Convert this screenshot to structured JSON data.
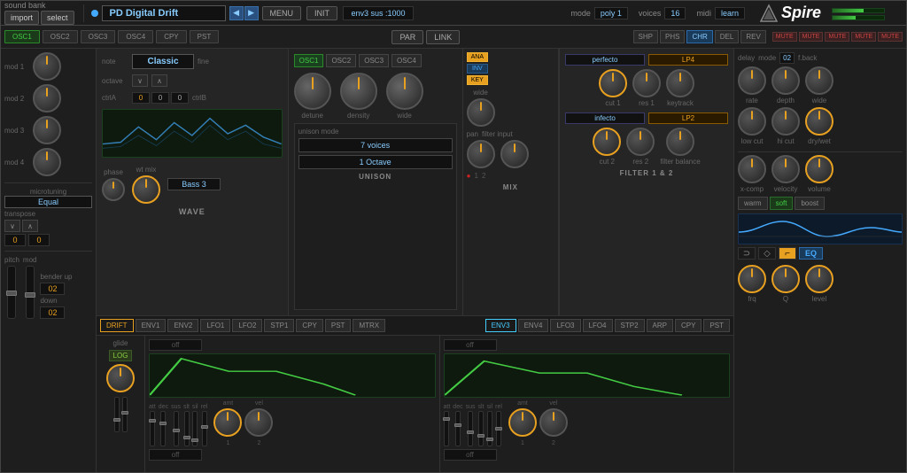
{
  "app": {
    "title": "Spire",
    "sound_bank_label": "sound bank"
  },
  "top_bar": {
    "import_btn": "import",
    "select_btn": "select",
    "patch_name": "PD Digital Drift",
    "menu_btn": "MENU",
    "init_btn": "INIT",
    "env_display": "env3 sus :1000",
    "mode_label": "mode",
    "mode_value": "poly 1",
    "voices_label": "voices",
    "voices_value": "16",
    "midi_label": "midi",
    "midi_value": "learn"
  },
  "second_bar": {
    "osc_tabs": [
      "OSC1",
      "OSC2",
      "OSC3",
      "OSC4",
      "CPY",
      "PST"
    ],
    "par_btn": "PAR",
    "link_btn": "LINK",
    "fx_tabs": [
      "SHP",
      "PHS",
      "CHR",
      "DEL",
      "REV"
    ],
    "mute_labels": [
      "MUTE",
      "MUTE",
      "MUTE",
      "MUTE",
      "MUTE"
    ]
  },
  "osc_left": {
    "note_label": "note",
    "classic_value": "Classic",
    "fine_label": "fine",
    "octave_label": "octave",
    "ctrla_label": "ctrlA",
    "ctrlb_label": "ctrlB",
    "oct_value": "0",
    "mote_value": "0",
    "cent_value": "0",
    "phase_label": "phase",
    "wtmix_label": "wt mix",
    "bass3_value": "Bass 3",
    "wave_title": "WAVE"
  },
  "unison": {
    "unison_mode_label": "unison mode",
    "voices_value": "7 voices",
    "octave_value": "1 Octave",
    "title": "UNISON"
  },
  "mix": {
    "title": "MIX",
    "wide_label": "wide",
    "pan_label": "pan",
    "filter_input_label": "filter input",
    "ana_btn": "ANA",
    "inv_btn": "INV",
    "key_btn": "KEY",
    "range_1": "1",
    "range_2": "2"
  },
  "filter": {
    "title": "FILTER 1 & 2",
    "perfecto_value": "perfecto",
    "lp4_value": "LP4",
    "infecto_value": "infecto",
    "lp2_value": "LP2",
    "cut1_label": "cut 1",
    "res1_label": "res 1",
    "keytrack_label": "keytrack",
    "cut2_label": "cut 2",
    "res2_label": "res 2",
    "filter_balance_label": "filter balance"
  },
  "delay": {
    "delay_label": "delay",
    "mode_label": "mode",
    "mode_value": "02",
    "f_back_label": "f.back",
    "rate_label": "rate",
    "depth_label": "depth",
    "wide_label": "wide",
    "low_cut_label": "low cut",
    "hi_cut_label": "hi cut",
    "dry_wet_label": "dry/wet"
  },
  "left_panel": {
    "mod1_label": "mod 1",
    "mod2_label": "mod 2",
    "mod3_label": "mod 3",
    "mod4_label": "mod 4",
    "microtuning_label": "microtuning",
    "equal_value": "Equal",
    "transpose_label": "transpose",
    "up_btn": "∧",
    "down_btn": "∨",
    "val1": "0",
    "val2": "0",
    "pitch_label": "pitch",
    "mod_label": "mod",
    "bender_up_label": "bender up",
    "bender_up_value": "02",
    "bender_down_label": "down",
    "bender_down_value": "02",
    "glide_label": "glide",
    "log_btn": "LOG"
  },
  "envelope1": {
    "att": "att",
    "dec": "dec",
    "sus": "sus",
    "slt": "slt",
    "sil": "sil",
    "rel": "rel",
    "amt_label": "amt",
    "vel_label": "vel",
    "off_display": "off",
    "off2_display": "off",
    "num1": "1",
    "num2": "2"
  },
  "bottom_tabs_left": [
    "DRIFT",
    "ENV1",
    "ENV2",
    "LFO1",
    "LFO2",
    "STP1",
    "CPY",
    "PST",
    "MTRX"
  ],
  "bottom_tabs_right": [
    "ENV3",
    "ENV4",
    "LFO3",
    "LFO4",
    "STP2",
    "ARP",
    "CPY",
    "PST"
  ],
  "xcomp": {
    "xcomp_label": "x-comp",
    "velocity_label": "velocity",
    "volume_label": "volume",
    "warm_btn": "warm",
    "soft_btn": "soft",
    "boost_btn": "boost",
    "eq_label": "EQ",
    "frq_label": "frq",
    "q_label": "Q",
    "level_label": "level"
  }
}
